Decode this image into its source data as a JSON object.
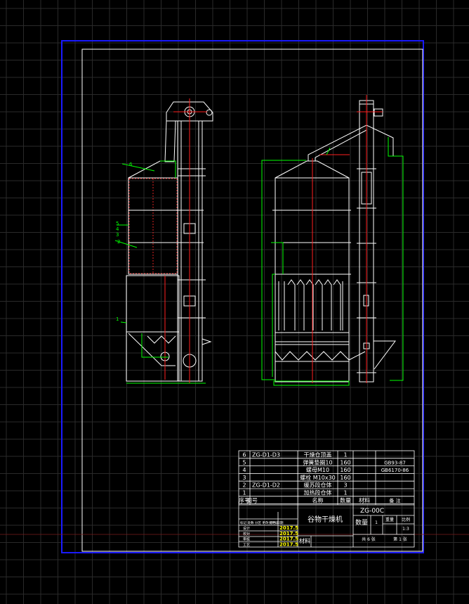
{
  "drawing": {
    "code": "ZG-00C",
    "title": "谷物干燥机",
    "quantity_label": "数量",
    "quantity_value": "1",
    "weight_label": "重量",
    "scale_label": "比例",
    "scale_value": "1:3",
    "sheets_total": "共 6 张",
    "sheet_no": "第 1 张",
    "material_label": "材料"
  },
  "parts_header": {
    "no": "序号",
    "drawing_no": "图号",
    "name": "名称",
    "qty": "数量",
    "material": "材料",
    "remark": "备 注"
  },
  "parts": [
    {
      "no": "6",
      "drawing_no": "ZG-D1-D3",
      "name": "干燥仓顶盖",
      "qty": "1",
      "remark": ""
    },
    {
      "no": "5",
      "drawing_no": "",
      "name": "弹簧垫圈10",
      "qty": "160",
      "remark": "GB93-87"
    },
    {
      "no": "4",
      "drawing_no": "",
      "name": "螺母M10",
      "qty": "160",
      "remark": "GB6170-86"
    },
    {
      "no": "3",
      "drawing_no": "",
      "name": "螺栓 M10x30",
      "qty": "160",
      "remark": ""
    },
    {
      "no": "2",
      "drawing_no": "ZG-D1-D2",
      "name": "缓苏段仓体",
      "qty": "3",
      "remark": ""
    },
    {
      "no": "1",
      "drawing_no": "",
      "name": "加热段仓体",
      "qty": "1",
      "remark": ""
    }
  ],
  "signoff": {
    "header": [
      "标记",
      "处数",
      "分区",
      "更改文件号",
      "签名",
      "日期"
    ],
    "rows": [
      {
        "role": "设计",
        "date": "2017.5"
      },
      {
        "role": "校对",
        "date": "2017.5"
      },
      {
        "role": "审核",
        "date": "2017.5"
      },
      {
        "role": "工艺",
        "date": "2017.5"
      }
    ]
  },
  "callouts": [
    "6",
    "5",
    "4",
    "3",
    "2",
    "1"
  ],
  "colors": {
    "background": "#000000",
    "grid": "#2a2a2a",
    "outer_frame": "#1a1aff",
    "line": "#ffffff",
    "center": "#ff2020",
    "dim": "#00e000"
  }
}
